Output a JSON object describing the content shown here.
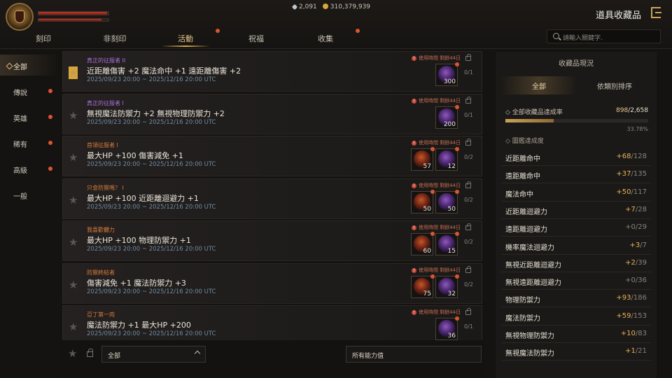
{
  "header": {
    "gems": "2,091",
    "gold": "310,379,939",
    "page_title": "道具收藏品"
  },
  "tabs": [
    {
      "label": "刻印",
      "active": false,
      "dot": false
    },
    {
      "label": "非刻印",
      "active": false,
      "dot": false
    },
    {
      "label": "活動",
      "active": true,
      "dot": true
    },
    {
      "label": "祝福",
      "active": false,
      "dot": false
    },
    {
      "label": "收集",
      "active": false,
      "dot": true
    }
  ],
  "search": {
    "placeholder": "請輸入關鍵字."
  },
  "sidebar": [
    {
      "label": "全部",
      "active": true,
      "dot": false
    },
    {
      "label": "傳說",
      "active": false,
      "dot": true
    },
    {
      "label": "英雄",
      "active": false,
      "dot": true
    },
    {
      "label": "稀有",
      "active": false,
      "dot": true
    },
    {
      "label": "高級",
      "active": false,
      "dot": true
    },
    {
      "label": "一般",
      "active": false,
      "dot": false
    }
  ],
  "items": [
    {
      "title": "真正的征服者 II",
      "title_color": "purple",
      "stats": "近距離傷害 +2 魔法命中 +1 遠距離傷害 +2",
      "date": "2025/09/23 20:00 ~ 2025/12/16 20:00 UTC",
      "time_left": "使用時間 剩餘44日",
      "count": "0/1",
      "starred": true,
      "slots": [
        {
          "type": "purple",
          "qty": "300"
        }
      ]
    },
    {
      "title": "真正的征服者 I",
      "title_color": "purple",
      "stats": "無視魔法防禦力 +2 無視物理防禦力 +2",
      "date": "2025/09/23 20:00 ~ 2025/12/16 20:00 UTC",
      "time_left": "使用時間 剩餘44日",
      "count": "0/1",
      "starred": false,
      "slots": [
        {
          "type": "purple",
          "qty": "200"
        }
      ]
    },
    {
      "title": "首領征服者 I",
      "title_color": "orange",
      "stats": "最大HP +100 傷害減免 +1",
      "date": "2025/09/23 20:00 ~ 2025/12/16 20:00 UTC",
      "time_left": "使用時間 剩餘44日",
      "count": "0/2",
      "starred": false,
      "slots": [
        {
          "type": "red",
          "qty": "57"
        },
        {
          "type": "purple",
          "qty": "12"
        }
      ]
    },
    {
      "title": "只會防禦嗎？ I",
      "title_color": "orange",
      "stats": "最大HP +100 近距離迴避力 +1",
      "date": "2025/09/23 20:00 ~ 2025/12/16 20:00 UTC",
      "time_left": "使用時間 剩餘44日",
      "count": "0/2",
      "starred": false,
      "slots": [
        {
          "type": "red",
          "qty": "50"
        },
        {
          "type": "purple",
          "qty": "50"
        }
      ]
    },
    {
      "title": "我喜歡體力",
      "title_color": "orange",
      "stats": "最大HP +100 物理防禦力 +1",
      "date": "2025/09/23 20:00 ~ 2025/12/16 20:00 UTC",
      "time_left": "使用時間 剩餘44日",
      "count": "0/2",
      "starred": false,
      "slots": [
        {
          "type": "red",
          "qty": "60"
        },
        {
          "type": "purple",
          "qty": "15"
        }
      ]
    },
    {
      "title": "防禦終結者",
      "title_color": "orange",
      "stats": "傷害減免 +1 魔法防禦力 +3",
      "date": "2025/09/23 20:00 ~ 2025/12/16 20:00 UTC",
      "time_left": "使用時間 剩餘44日",
      "count": "0/2",
      "starred": false,
      "slots": [
        {
          "type": "red",
          "qty": "75"
        },
        {
          "type": "purple",
          "qty": "32"
        }
      ]
    },
    {
      "title": "亞丁第一肉",
      "title_color": "orange",
      "stats": "魔法防禦力 +1 最大HP +200",
      "date": "2025/09/23 20:00 ~ 2025/12/16 20:00 UTC",
      "time_left": "使用時間 剩餘44日",
      "count": "0/1",
      "starred": false,
      "slots": [
        {
          "type": "purple",
          "qty": "36"
        }
      ]
    }
  ],
  "bottom": {
    "filter1": "全部",
    "filter2": "所有能力值"
  },
  "panel": {
    "title": "收藏品現況",
    "tab_all": "全部",
    "tab_sort": "依類別排序",
    "rate_label": "全部收藏品達成率",
    "rate_done": "898",
    "rate_total": "/2,658",
    "rate_fraction": 0.3378,
    "rate_pct": "33.78%",
    "sub_label": "圖鑑達成度",
    "stats": [
      {
        "name": "近距離命中",
        "plus": "+68",
        "total": "/128",
        "active": true
      },
      {
        "name": "遠距離命中",
        "plus": "+37",
        "total": "/135",
        "active": true
      },
      {
        "name": "魔法命中",
        "plus": "+50",
        "total": "/117",
        "active": true
      },
      {
        "name": "近距離迴避力",
        "plus": "+7",
        "total": "/28",
        "active": true
      },
      {
        "name": "遠距離迴避力",
        "plus": "+0",
        "total": "/29",
        "active": false
      },
      {
        "name": "機率魔法迴避力",
        "plus": "+3",
        "total": "/7",
        "active": true
      },
      {
        "name": "無視近距離迴避力",
        "plus": "+2",
        "total": "/39",
        "active": true
      },
      {
        "name": "無視遠距離迴避力",
        "plus": "+0",
        "total": "/36",
        "active": false
      },
      {
        "name": "物理防禦力",
        "plus": "+93",
        "total": "/186",
        "active": true
      },
      {
        "name": "魔法防禦力",
        "plus": "+59",
        "total": "/153",
        "active": true
      },
      {
        "name": "無視物理防禦力",
        "plus": "+10",
        "total": "/83",
        "active": true
      },
      {
        "name": "無視魔法防禦力",
        "plus": "+1",
        "total": "/21",
        "active": true
      }
    ]
  }
}
